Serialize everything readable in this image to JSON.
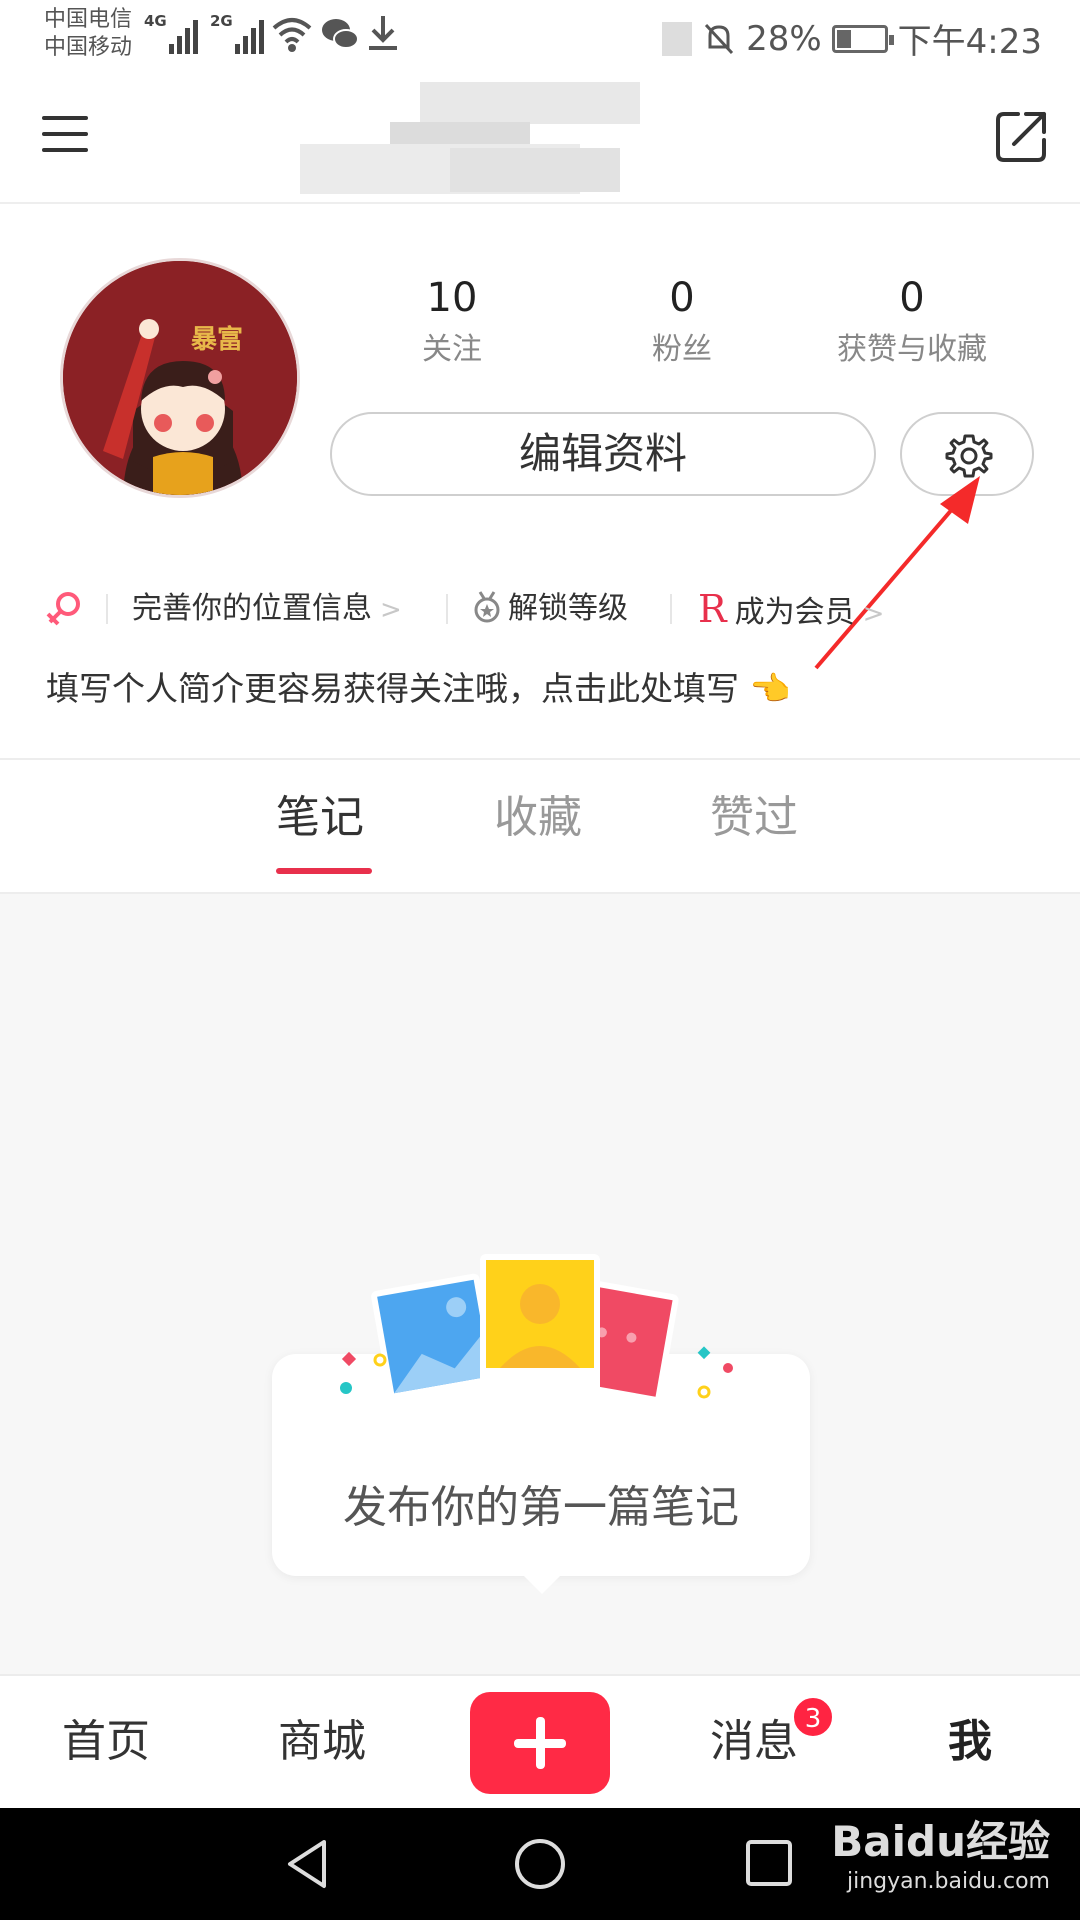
{
  "status_bar": {
    "carrier_1": "中国电信",
    "carrier_2": "中国移动",
    "net_1": "4G",
    "net_2": "2G",
    "battery": "28%",
    "time": "下午4:23"
  },
  "top_bar": {
    "menu_icon": "hamburger-menu-icon",
    "share_icon": "share-external-icon"
  },
  "profile": {
    "stats": [
      {
        "value": "10",
        "label": "关注"
      },
      {
        "value": "0",
        "label": "粉丝"
      },
      {
        "value": "0",
        "label": "获赞与收藏"
      }
    ],
    "edit_label": "编辑资料",
    "settings_icon": "gear-icon",
    "avatar_text": "暴富",
    "meta": {
      "location": "完善你的位置信息",
      "level": "解锁等级",
      "vip_mark": "R",
      "vip": "成为会员"
    },
    "bio_prompt": "填写个人简介更容易获得关注哦，点击此处填写"
  },
  "tabs": [
    {
      "label": "笔记",
      "active": true
    },
    {
      "label": "收藏",
      "active": false
    },
    {
      "label": "赞过",
      "active": false
    }
  ],
  "empty_state": {
    "text": "发布你的第一篇笔记"
  },
  "bottom_nav": {
    "home": "首页",
    "mall": "商城",
    "messages": "消息",
    "messages_badge": "3",
    "me": "我"
  },
  "watermark": {
    "brand": "Baidu经验",
    "url": "jingyan.baidu.com"
  },
  "colors": {
    "accent": "#ff2442",
    "tab_indicator": "#e8304c"
  }
}
